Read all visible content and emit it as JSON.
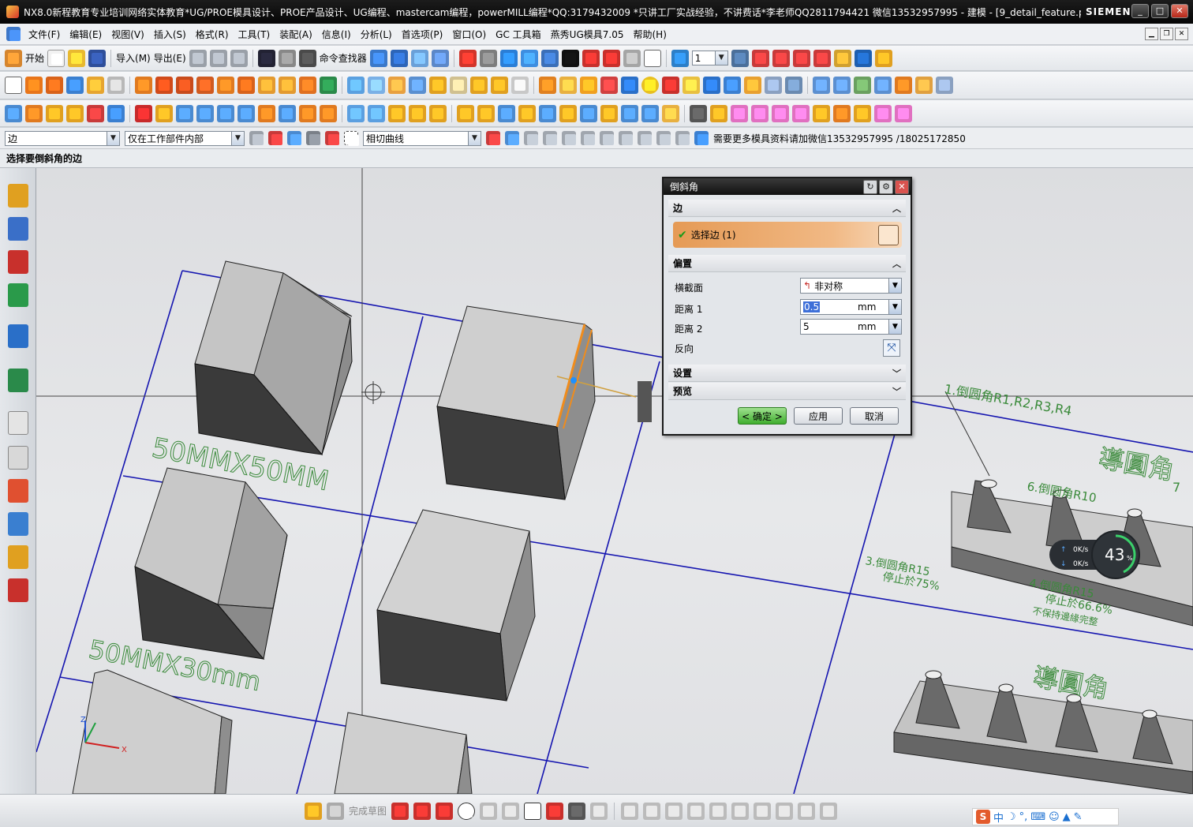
{
  "window": {
    "title": "NX8.0新程教育专业培训网络实体教育*UG/PROE模具设计、PROE产品设计、UG编程、mastercam编程，powerMILL编程*QQ:3179432009 *只讲工厂实战经验，不讲费话*李老师QQ2811794421 微信13532957995 - 建模 - [9_detail_feature.p...",
    "brand": "SIEMENS",
    "controls": [
      "_",
      "□",
      "✕"
    ]
  },
  "menu": [
    "文件(F)",
    "编辑(E)",
    "视图(V)",
    "插入(S)",
    "格式(R)",
    "工具(T)",
    "装配(A)",
    "信息(I)",
    "分析(L)",
    "首选项(P)",
    "窗口(O)",
    "GC 工具箱",
    "燕秀UG模具7.05",
    "帮助(H)"
  ],
  "toolbar1": {
    "start": "开始",
    "import": "导入(M)",
    "export": "导出(E)",
    "command_finder": "命令查找器",
    "layer_value": "1"
  },
  "selection_bar": {
    "type_filter": "边",
    "scope": "仅在工作部件内部",
    "curve_rule": "相切曲线",
    "note": "需要更多模具资料请加微信13532957995 /18025172850"
  },
  "cue_line": "选择要倒斜角的边",
  "dialog": {
    "title": "倒斜角",
    "edge_section": "边",
    "select_edge": "选择边 (1)",
    "offset_section": "偏置",
    "cross_section_label": "横截面",
    "cross_section_value": "非对称",
    "distance1_label": "距离 1",
    "distance1_value": "0.5",
    "distance2_label": "距离 2",
    "distance2_value": "5",
    "unit": "mm",
    "reverse_label": "反向",
    "settings_section": "设置",
    "preview_section": "预览",
    "ok": "< 确定 >",
    "apply": "应用",
    "cancel": "取消"
  },
  "viewport_labels": {
    "label_50x50": "50MMX50MM",
    "label_50x30": "50MMX30mm",
    "note1": "1.倒圆角R1,R2,R3,R4",
    "note6": "6.倒圆角R10",
    "note3_line1": "3.倒圆角R15",
    "note3_line2": "停止於75%",
    "note4_line1": "4.倒圆角R15",
    "note4_line2": "停止於66.6%",
    "note4_line3": "不保持邊緣完整",
    "title_big1": "導圓角",
    "title_big2": "導圓角",
    "note7": "7"
  },
  "net_widget": {
    "up": "0K/s",
    "down": "0K/s",
    "percent": "43",
    "percent_unit": "%"
  },
  "bottom_bar": {
    "finish_sketch": "完成草图"
  },
  "ime": {
    "logo": "S",
    "lang": "中"
  },
  "colors": {
    "title_bg": "#0d0d0d",
    "select_accent": "#e59a55",
    "sketch_line": "#1010b0",
    "note_green": "#3a8a3a",
    "selected_edge": "#f08c1c"
  }
}
